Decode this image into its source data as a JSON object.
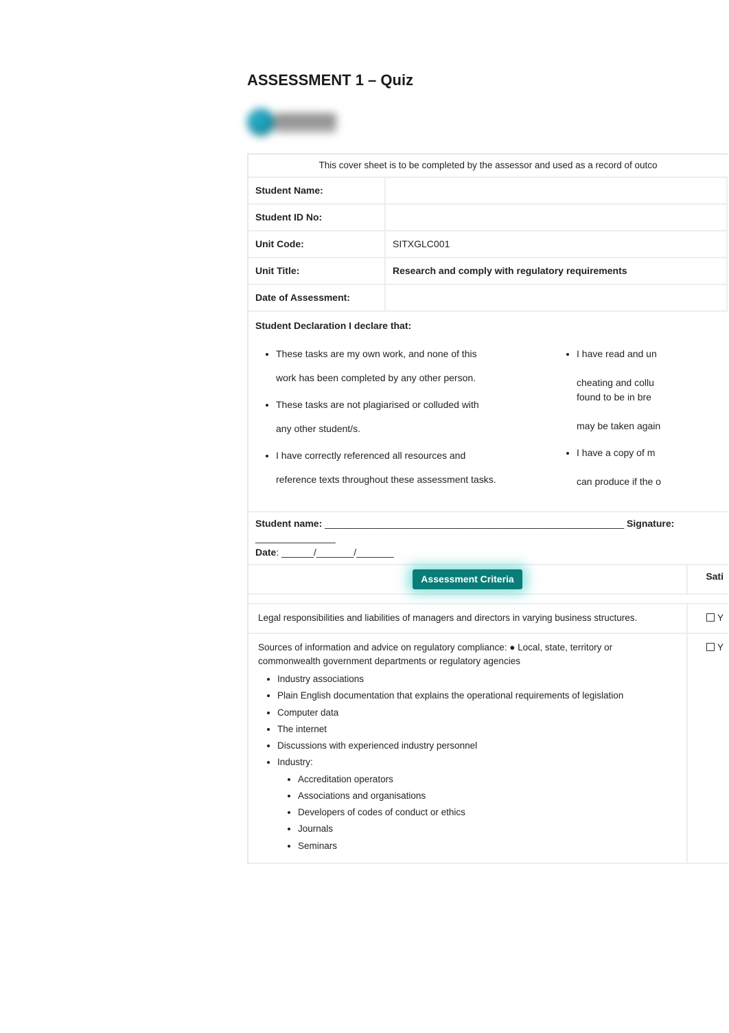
{
  "title": "ASSESSMENT 1 – Quiz",
  "cover_note": "This cover sheet is to be completed by the assessor and used as a record of outco",
  "fields": {
    "student_name_label": "Student Name:",
    "student_name_value": "",
    "student_id_label": "Student ID No:",
    "student_id_value": "",
    "unit_code_label": "Unit Code:",
    "unit_code_value": "SITXGLC001",
    "unit_title_label": "Unit Title:",
    "unit_title_value": "Research and comply with regulatory requirements",
    "date_assessment_label": "Date of Assessment:",
    "date_assessment_value": ""
  },
  "declaration": {
    "header": "Student Declaration I declare that:",
    "left_items": [
      {
        "main": "These tasks are my own work, and none of this",
        "sub": "work has been completed by any other person."
      },
      {
        "main": "These tasks are not plagiarised or colluded with",
        "sub": "any other student/s."
      },
      {
        "main": "I have correctly referenced all resources and",
        "sub": "reference texts throughout these assessment tasks."
      }
    ],
    "right_items": [
      "I have read and un",
      "cheating and collu",
      "found to be in bre",
      "may be taken again",
      "I have a copy of m",
      "can produce if the o"
    ]
  },
  "signature_line": {
    "name_label": "Student name: ",
    "name_blank": "________________________________________________________",
    "signature_label": " Signature: ",
    "signature_blank": "_______________",
    "date_label": "Date",
    "date_blank": ": ______/_______/_______"
  },
  "criteria_header": {
    "left": "Assessment Criteria",
    "right": "Sati"
  },
  "criteria": [
    {
      "text": "Legal responsibilities and liabilities of managers and directors in varying business structures.",
      "result": "Y"
    },
    {
      "intro": "Sources of information and advice on regulatory compliance: ●  Local, state, territory or commonwealth government departments or  regulatory agencies",
      "bullets": [
        "Industry associations",
        "Plain English documentation that explains the operational requirements of legislation",
        "Computer data",
        "The internet",
        "Discussions with experienced industry personnel",
        "Industry:"
      ],
      "sub_bullets": [
        "Accreditation operators",
        "Associations and organisations",
        "Developers of codes of conduct or ethics",
        "Journals",
        "Seminars"
      ],
      "result": "Y"
    }
  ]
}
